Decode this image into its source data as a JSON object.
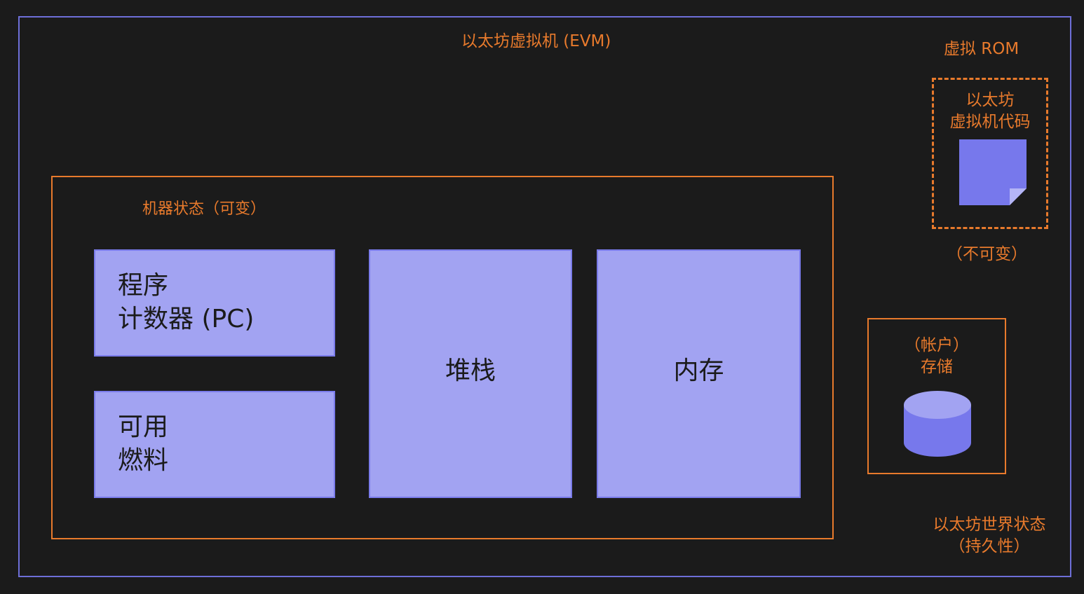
{
  "evm": {
    "title": "以太坊虚拟机 (EVM)"
  },
  "machine_state": {
    "label": "机器状态（可变）",
    "program_counter": {
      "line1": "程序",
      "line2": "计数器 (PC)"
    },
    "available_gas": {
      "line1": "可用",
      "line2": "燃料"
    },
    "stack": {
      "label": "堆栈"
    },
    "memory": {
      "label": "内存"
    }
  },
  "virtual_rom": {
    "title": "虚拟 ROM",
    "code_line1": "以太坊",
    "code_line2": "虚拟机代码",
    "immutable_label": "（不可变）"
  },
  "storage": {
    "line1": "（帐户）",
    "line2": "存储"
  },
  "world_state": {
    "line1": "以太坊世界状态",
    "line2": "（持久性）"
  },
  "colors": {
    "background": "#1b1b1b",
    "evm_border": "#6e6fd8",
    "orange_accent": "#e87a2c",
    "block_fill": "#a2a3f2",
    "icon_fill": "#7778ec"
  },
  "icons": [
    "document-icon",
    "database-icon"
  ]
}
